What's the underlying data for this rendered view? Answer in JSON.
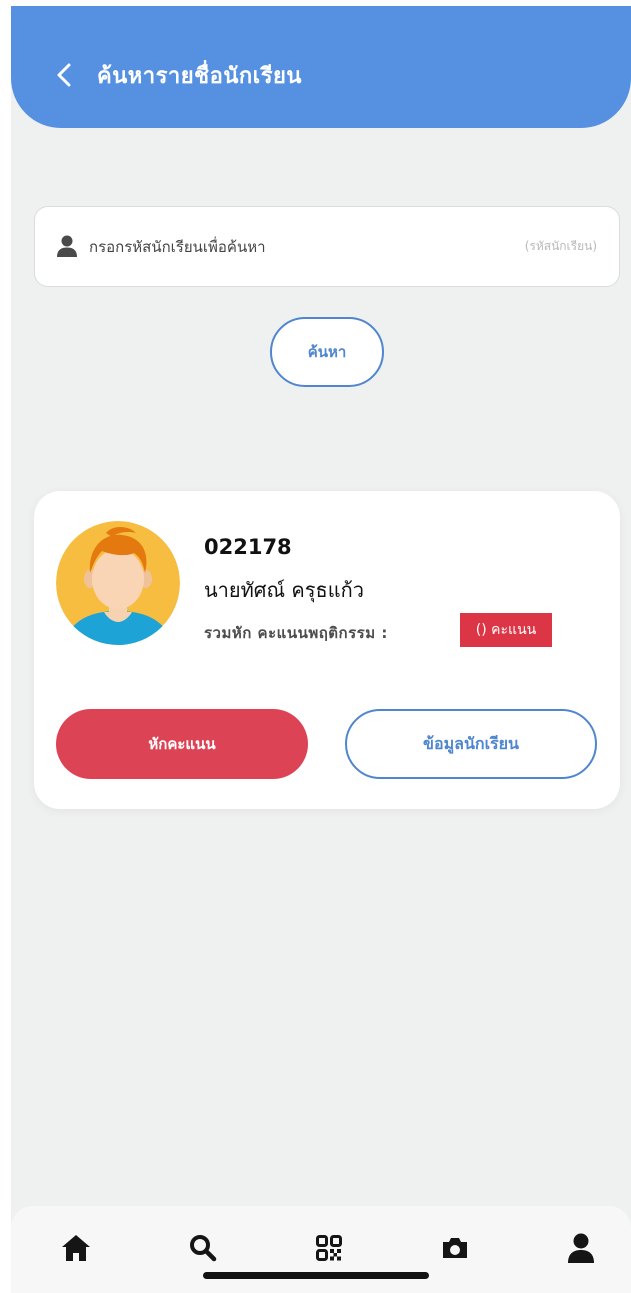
{
  "header": {
    "title": "ค้นหารายชื่อนักเรียน",
    "back_icon": "chevron-left-icon",
    "background": "#5590e1"
  },
  "search": {
    "value": "",
    "placeholder": "กรอกรหัสนักเรียนเพื่อค้นหา",
    "hint": "(รหัสนักเรียน)",
    "icon": "user-icon",
    "button_label": "ค้นหา"
  },
  "student": {
    "id": "022178",
    "name": "นายทัศณ์ ครุธแก้ว",
    "deduct_label": "รวมหัก คะแนนพฤติกรรม :",
    "score_badge": "() คะแนน",
    "badge_color": "#dc3545"
  },
  "actions": {
    "deduct_label": "หักคะแนน",
    "info_label": "ข้อมูลนักเรียน",
    "deduct_color": "#dc4455",
    "accent_color": "#4f86cf"
  },
  "nav": {
    "items": [
      {
        "icon": "home-icon"
      },
      {
        "icon": "search-icon"
      },
      {
        "icon": "qr-code-icon"
      },
      {
        "icon": "camera-icon"
      },
      {
        "icon": "profile-icon"
      }
    ]
  }
}
